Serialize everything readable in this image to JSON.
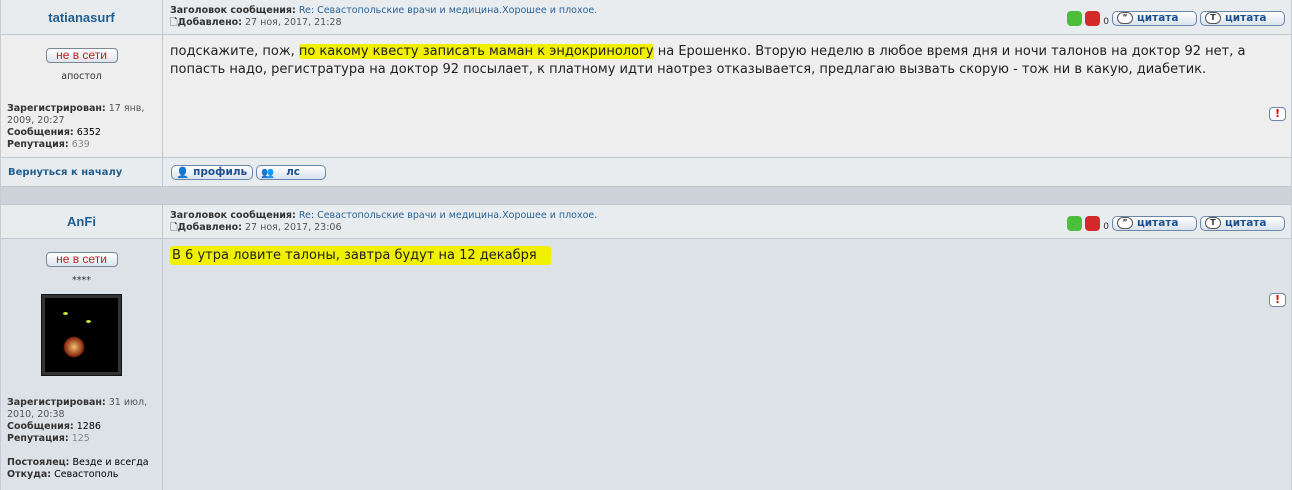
{
  "posts": [
    {
      "author": "tatianasurf",
      "status": "не в сети",
      "rank": "апостол",
      "subject_label": "Заголовок сообщения:",
      "subject": "Re: Севастопольские врачи и медицина.Хорошее и плохое.",
      "added_label": "Добавлено:",
      "added": "27 ноя, 2017, 21:28",
      "registered_label": "Зарегистрирован:",
      "registered": "17 янв, 2009, 20:27",
      "posts_label": "Сообщения:",
      "posts": "6352",
      "rep_label": "Репутация:",
      "rep": "639",
      "message_pre": "подскажите, пож, ",
      "message_hl": "по какому квесту записать маман к эндокринологу",
      "message_post": " на Ерошенко. Вторую неделю в любое время дня и ночи талонов на доктор 92 нет, а попасть надо, регистратура на доктор 92 посылает, к платному идти наотрез отказывается, предлагаю вызвать скорую - тож ни в какую, диабетик.",
      "rating": "0"
    },
    {
      "author": "AnFi",
      "status": "не в сети",
      "rank": "****",
      "subject_label": "Заголовок сообщения:",
      "subject": "Re: Севастопольские врачи и медицина.Хорошее и плохое.",
      "added_label": "Добавлено:",
      "added": "27 ноя, 2017, 23:06",
      "registered_label": "Зарегистрирован:",
      "registered": "31 июл, 2010, 20:38",
      "posts_label": "Сообщения:",
      "posts": "1286",
      "rep_label": "Репутация:",
      "rep": "125",
      "resident_label": "Постоялец:",
      "resident": "Везде и всегда",
      "from_label": "Откуда:",
      "from": "Севастополь",
      "message_hl": "В 6 утра ловите талоны, завтра будут на 12 декабря",
      "rating": "0"
    }
  ],
  "buttons": {
    "quote": "цитата",
    "quote2": "цитата",
    "profile": "профиль",
    "pm": "лс",
    "report": "!"
  },
  "back_to_top": "Вернуться к началу"
}
